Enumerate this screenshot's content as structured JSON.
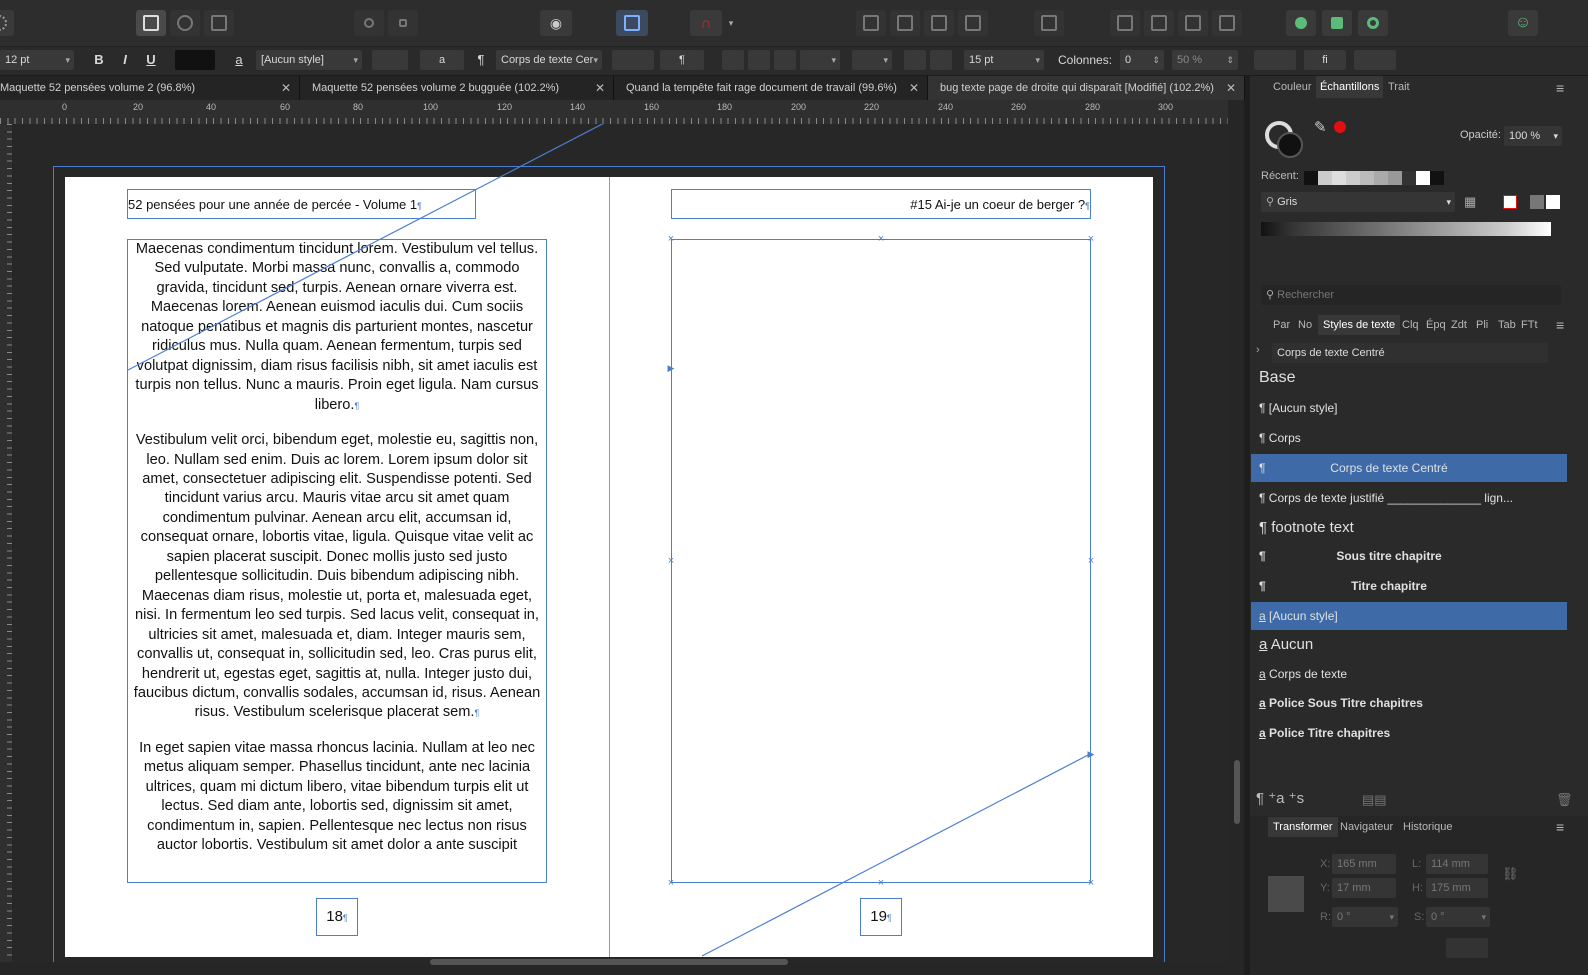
{
  "context_toolbar": {
    "font_size": "12 pt",
    "bold": "B",
    "italic": "I",
    "underline": "U",
    "char_style_icon": "a",
    "char_style": "[Aucun style]",
    "para_icon_a": "a",
    "pilcrow": "¶",
    "para_style": "Corps de texte Cer",
    "pilcrow2": "¶",
    "leading": "15 pt",
    "columns_label": "Colonnes:",
    "columns_value": "0",
    "gutter": "50 %",
    "ligature_icon": "fi"
  },
  "tabs": [
    {
      "label": "Maquette 52 pensées volume 2 (96.8%)"
    },
    {
      "label": "Maquette 52 pensées volume 2 bugguée (102.2%)"
    },
    {
      "label": "Quand la tempête fait rage document de travail (99.6%)"
    },
    {
      "label": "bug texte page de droite qui disparaît [Modifié] (102.2%)"
    }
  ],
  "ruler": {
    "labels": [
      "0",
      "20",
      "40",
      "60",
      "80",
      "100",
      "120",
      "140",
      "160",
      "180",
      "200",
      "220",
      "240",
      "260",
      "280",
      "300"
    ]
  },
  "left_page": {
    "header": "52 pensées pour une année de percée - Volume 1",
    "paragraphs": [
      "Maecenas condimentum tincidunt lorem. Vestibulum vel tellus. Sed vulputate. Morbi massa nunc, convallis a, commodo gravida, tincidunt sed, turpis. Aenean ornare viverra est. Maecenas lorem. Aenean euismod iaculis dui. Cum sociis natoque penatibus et magnis dis parturient montes, nascetur ridiculus mus. Nulla quam. Aenean fermentum, turpis sed volutpat dignissim, diam risus facilisis nibh, sit amet iaculis est turpis non tellus. Nunc a mauris. Proin eget ligula. Nam cursus libero.",
      "Vestibulum velit orci, bibendum eget, molestie eu, sagittis non, leo. Nullam sed enim. Duis ac lorem. Lorem ipsum dolor sit amet, consectetuer adipiscing elit. Suspendisse potenti. Sed tincidunt varius arcu. Mauris vitae arcu sit amet quam condimentum pulvinar. Aenean arcu elit, accumsan id, consequat ornare, lobortis vitae, ligula. Quisque vitae velit ac sapien placerat suscipit. Donec mollis justo sed justo pellentesque sollicitudin. Duis bibendum adipiscing nibh. Maecenas diam risus, molestie ut, porta et, malesuada eget, nisi. In fermentum leo sed turpis. Sed lacus velit, consequat in, ultricies sit amet, malesuada et, diam. Integer mauris sem, convallis ut, consequat in, sollicitudin sed, leo. Cras purus elit, hendrerit ut, egestas eget, sagittis at, nulla. Integer justo dui, faucibus dictum, convallis sodales, accumsan id, risus. Aenean risus. Vestibulum scelerisque placerat sem.",
      "In eget sapien vitae massa rhoncus lacinia. Nullam at leo nec metus aliquam semper. Phasellus tincidunt, ante nec lacinia ultrices, quam mi dictum libero, vitae bibendum turpis elit ut lectus. Sed diam ante, lobortis sed, dignissim sit amet, condimentum in, sapien. Pellentesque nec lectus non risus auctor lobortis. Vestibulum sit amet dolor a ante suscipit"
    ],
    "page_number": "18"
  },
  "right_page": {
    "header": "#15 Ai-je un coeur de berger ?",
    "page_number": "19"
  },
  "panel": {
    "top_tabs": [
      "Couleur",
      "Échantillons",
      "Trait"
    ],
    "opacity_label": "Opacité:",
    "opacity_value": "100 %",
    "recent_label": "Récent:",
    "palette": "Gris",
    "search_placeholder": "Rechercher",
    "style_tabs": [
      "Par",
      "No",
      "Styles de texte",
      "Clq",
      "Épq",
      "Zdt",
      "Pli",
      "Tab",
      "FTt"
    ],
    "current_style": "Corps de texte Centré",
    "styles": [
      {
        "icon": "",
        "label": "Base"
      },
      {
        "icon": "¶",
        "label": "[Aucun style]"
      },
      {
        "icon": "¶",
        "label": "Corps"
      },
      {
        "icon": "¶",
        "label": "Corps de texte Centré"
      },
      {
        "icon": "¶",
        "label": "Corps de texte justifié ______________ lign..."
      },
      {
        "icon": "¶",
        "label": "footnote text"
      },
      {
        "icon": "¶",
        "label": "Sous titre chapitre"
      },
      {
        "icon": "¶",
        "label": "Titre chapitre"
      },
      {
        "icon": "a",
        "label": "[Aucun style]"
      },
      {
        "icon": "a",
        "label": "Aucun"
      },
      {
        "icon": "a",
        "label": "Corps de texte"
      },
      {
        "icon": "a",
        "label": "Police Sous Titre chapitres"
      },
      {
        "icon": "a",
        "label": "Police Titre chapitres"
      }
    ],
    "bottom_icons": "¶ ⁺a ⁺s",
    "transform_tabs": [
      "Transformer",
      "Navigateur",
      "Historique"
    ],
    "transform": {
      "x_label": "X:",
      "x": "165 mm",
      "y_label": "Y:",
      "y": "17 mm",
      "l_label": "L:",
      "l": "114 mm",
      "h_label": "H:",
      "h": "175 mm",
      "r_label": "R:",
      "r": "0 °",
      "s_label": "S:",
      "s": "0 °"
    },
    "colors": {
      "accent": "#3e6aa8",
      "frame": "#4a7fd0",
      "red": "#e01010"
    }
  }
}
